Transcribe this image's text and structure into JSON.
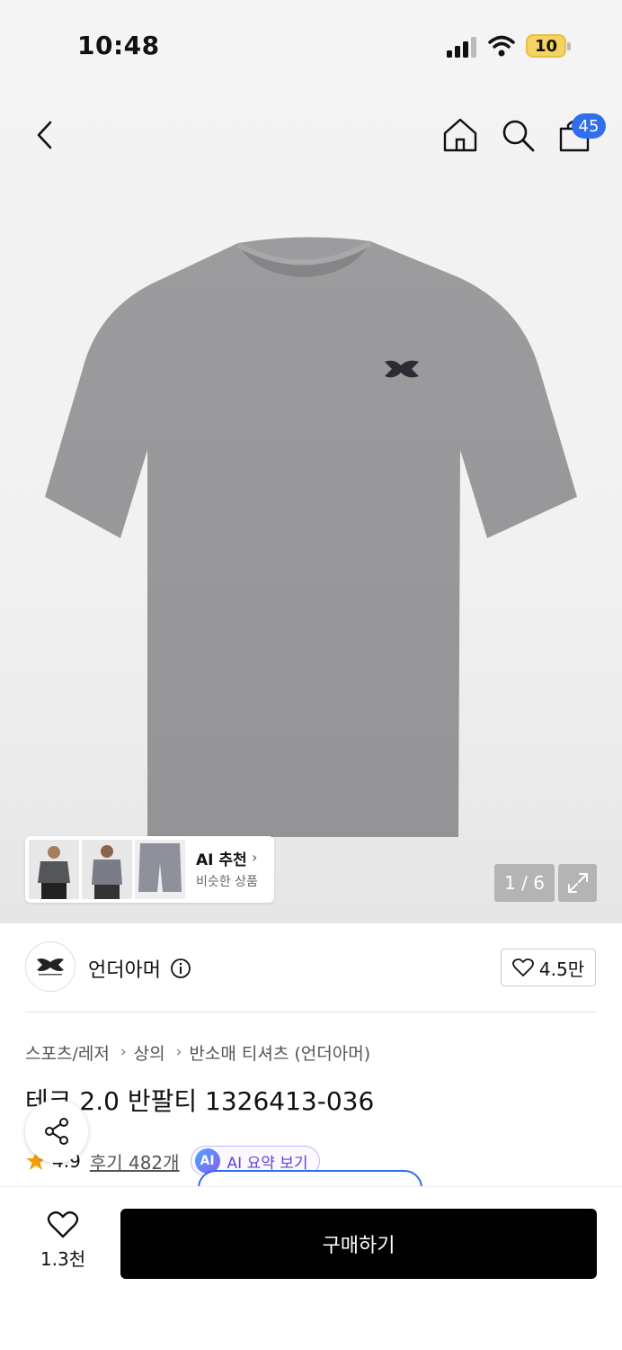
{
  "status_bar": {
    "time": "10:48",
    "battery": "10"
  },
  "nav": {
    "cart_count": "45"
  },
  "gallery": {
    "page_counter": "1 / 6",
    "ai_reco": {
      "title": "AI 추천",
      "subtitle": "비슷한 상품"
    }
  },
  "brand": {
    "name": "언더아머",
    "likes": "4.5만"
  },
  "breadcrumb": [
    "스포츠/레저",
    "상의",
    "반소매 티셔츠 (언더아머)"
  ],
  "product": {
    "title": "테크 2.0 반팔티 1326413-036",
    "rating": "4.9",
    "review_label": "후기 482개",
    "ai_summary": {
      "badge": "AI",
      "label": "AI 요약 보기"
    }
  },
  "bottom_bar": {
    "wish_count": "1.3천",
    "buy_label": "구매하기"
  },
  "colors": {
    "accent_blue": "#2f6fee",
    "star": "#f59e0b",
    "buy_button": "#000000",
    "ai_purple": "#6b3fd6"
  }
}
